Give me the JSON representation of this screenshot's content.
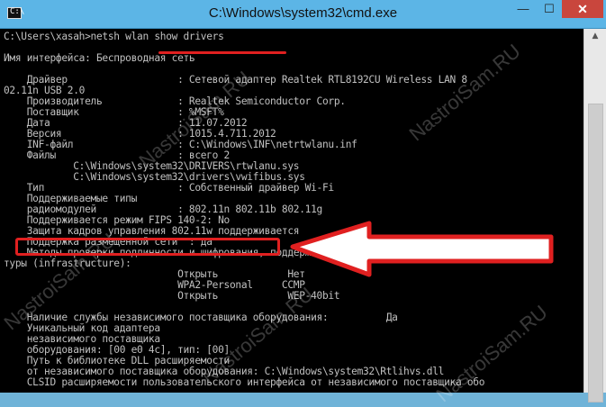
{
  "window": {
    "title": "C:\\Windows\\system32\\cmd.exe",
    "icon_text": "C:\\",
    "minimize_glyph": "—",
    "maximize_glyph": "☐",
    "close_glyph": "✕"
  },
  "console": {
    "lines": [
      "C:\\Users\\xasah>netsh wlan show drivers",
      "",
      "Имя интерфейса: Беспроводная сеть",
      "",
      "    Драйвер                   : Сетевой адаптер Realtek RTL8192CU Wireless LAN 8",
      "02.11n USB 2.0",
      "    Производитель             : Realtek Semiconductor Corp.",
      "    Поставщик                 : %MSFT%",
      "    Дата                      : 11.07.2012",
      "    Версия                    : 1015.4.711.2012",
      "    INF-файл                  : C:\\Windows\\INF\\netrtwlanu.inf",
      "    Файлы                     : всего 2",
      "            C:\\Windows\\system32\\DRIVERS\\rtwlanu.sys",
      "            C:\\Windows\\system32\\drivers\\vwifibus.sys",
      "    Тип                       : Собственный драйвер Wi-Fi",
      "    Поддерживаемые типы",
      "    радиомодулей              : 802.11n 802.11b 802.11g",
      "    Поддерживается режим FIPS 140-2: No",
      "    Защита кадров управления 802.11w поддерживается",
      "    Поддержка размещенной сети  : да",
      "    Методы проверки подлинности и шифрования, поддерживаемые в режиме инфраструк",
      "туры (infrastructure):",
      "                              Открыть            Нет",
      "                              WPA2-Personal     CCMP",
      "                              Открыть            WEP-40bit",
      "",
      "    Наличие службы независимого поставщика оборудования:          Да",
      "    Уникальный код адаптера",
      "    независимого поставщика",
      "    оборудования: [00 e0 4c], тип: [00]",
      "    Путь к библиотеке DLL расширяемости",
      "    от независимого поставщика оборудования: C:\\Windows\\system32\\Rtlihvs.dll",
      "    CLSID расширяемости пользовательского интерфейса от независимого поставщика обо"
    ]
  },
  "watermarks": [
    "NastroiSam.RU",
    "NastroiSam.RU",
    "NastroiSam.RU",
    "NastroiSam.RU",
    "NastroiSam.RU"
  ],
  "colors": {
    "annotation": "#e02020",
    "console_text": "#c0c0c0",
    "titlebar": "#5cb5e6"
  }
}
